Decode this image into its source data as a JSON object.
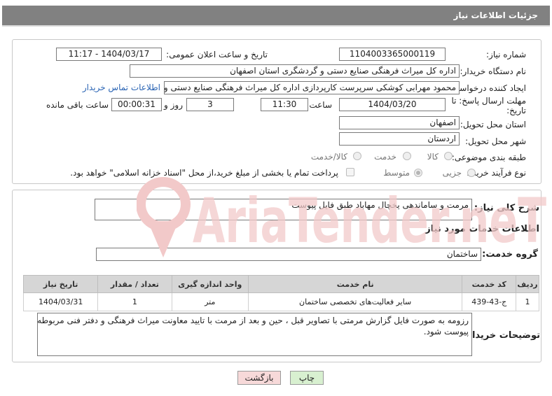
{
  "header": {
    "title": "جزئیات اطلاعات نیاز"
  },
  "form": {
    "need_number_label": "شماره نیاز:",
    "need_number": "1104003365000119",
    "announce_label": "تاریخ و ساعت اعلان عمومی:",
    "announce_value": "1404/03/17 - 11:17",
    "buyer_org_label": "نام دستگاه خریدار:",
    "buyer_org": "اداره کل میراث فرهنگی  صنایع دستی و گردشگری استان اصفهان",
    "requester_label": "ایجاد کننده درخواست:",
    "requester": "محمود مهرابی کوشکی سرپرست کارپردازی اداره کل میراث فرهنگی  صنایع دستی و گردشگری استان اصفهان",
    "contact_link": "اطلاعات تماس خریدار",
    "deadline_label_1": "مهلت ارسال پاسخ: تا",
    "deadline_label_2": "تاریخ:",
    "deadline_date": "1404/03/20",
    "time_label": "ساعت",
    "deadline_time": "11:30",
    "days_value": "3",
    "days_label": "روز و",
    "remaining_time": "00:00:31",
    "remaining_label": "ساعت باقی مانده",
    "province_label": "استان محل تحویل:",
    "province": "اصفهان",
    "city_label": "شهر محل تحویل:",
    "city": "اردستان",
    "category_label": "طبقه بندی موضوعی:",
    "category_options": [
      "کالا",
      "خدمت",
      "کالا/خدمت"
    ],
    "process_label": "نوع فرآیند خرید :",
    "process_options": [
      "جزیی",
      "متوسط"
    ],
    "payment_text": "پرداخت تمام یا بخشی از مبلغ خرید،از محل \"اسناد خزانه اسلامی\" خواهد بود."
  },
  "summary": {
    "label": "شرح کلی نیاز:",
    "text": "مرمت و ساماندهی یخچال مهاباد طبق فایل پیوست"
  },
  "services": {
    "section_title": "اطلاعات خدمات مورد نیاز",
    "group_label": "گروه خدمت:",
    "group_value": "ساختمان",
    "columns": [
      "ردیف",
      "کد خدمت",
      "نام خدمت",
      "واحد اندازه گیری",
      "تعداد / مقدار",
      "تاریخ نیاز"
    ],
    "rows": [
      {
        "row": "1",
        "code": "ج-43-439",
        "name": "سایر فعالیت‌های تخصصی ساختمان",
        "unit": "متر",
        "qty": "1",
        "date": "1404/03/31"
      }
    ]
  },
  "buyer_notes": {
    "label": "توضیحات خریدار:",
    "line1": "رزومه به صورت فایل گزارش مرمتی با تصاویر قبل ، حین و بعد از مرمت با تایید معاونت میراث فرهنگی و دفتر فنی مربوطه",
    "line2": "پیوست شود."
  },
  "buttons": {
    "print": "چاپ",
    "back": "بازگشت"
  },
  "watermark": {
    "text": "AriaTender.neT"
  },
  "colors": {
    "header_bg": "#818181",
    "link": "#2a64b4",
    "back_button_bg": "#f7d9d9",
    "print_button_bg": "#d8f0d0",
    "watermark": "#f2c9c9"
  }
}
